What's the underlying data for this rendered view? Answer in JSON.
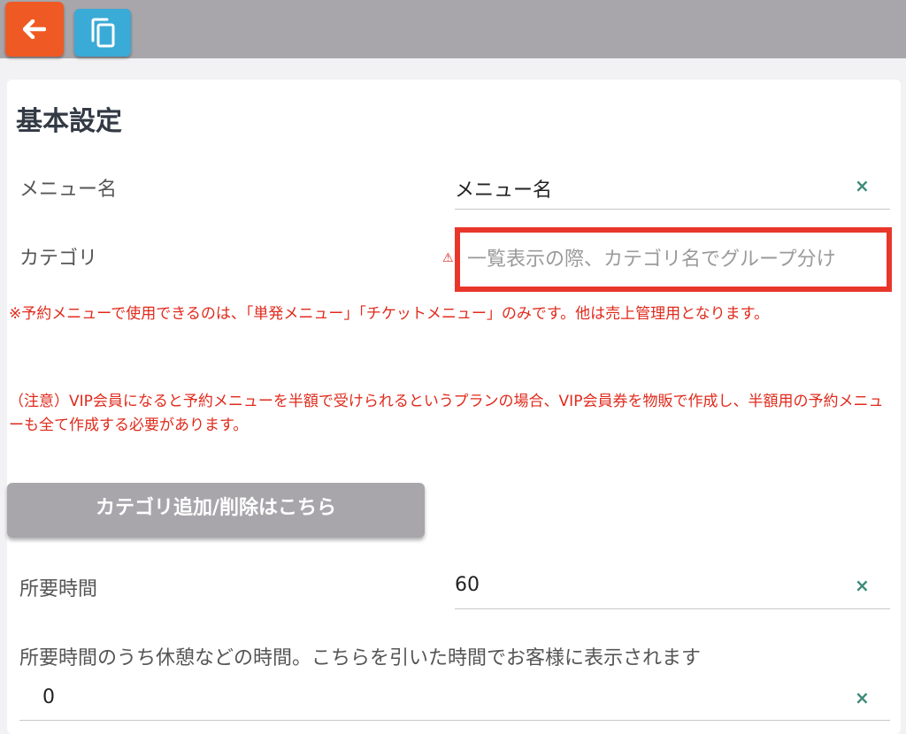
{
  "toolbar": {
    "back_icon": "arrow-left-icon",
    "copy_icon": "copy-icon"
  },
  "section": {
    "title": "基本設定"
  },
  "fields": {
    "menu_name": {
      "label": "メニュー名",
      "value": "メニュー名"
    },
    "category": {
      "label": "カテゴリ",
      "placeholder": "一覧表示の際、カテゴリ名でグループ分け",
      "warning_icon": "warning-icon"
    },
    "duration": {
      "label": "所要時間",
      "value": "60"
    },
    "break_time": {
      "label": "所要時間のうち休憩などの時間。こちらを引いた時間でお客様に表示されます",
      "value": "0"
    }
  },
  "notices": {
    "reservation": "※予約メニューで使用できるのは、「単発メニュー」「チケットメニュー」のみです。他は売上管理用となります。",
    "caution": "（注意）VIP会員になると予約メニューを半額で受けられるというプランの場合、VIP会員券を物販で作成し、半額用の予約メニューも全て作成する必要があります。"
  },
  "category_button": {
    "label": "カテゴリ追加/削除はこちら"
  },
  "clear_symbol": "×",
  "colors": {
    "accent_orange": "#ef5a24",
    "accent_blue": "#3aaad6",
    "alert_red": "#e8372a",
    "clear_green": "#3c8a7a"
  }
}
